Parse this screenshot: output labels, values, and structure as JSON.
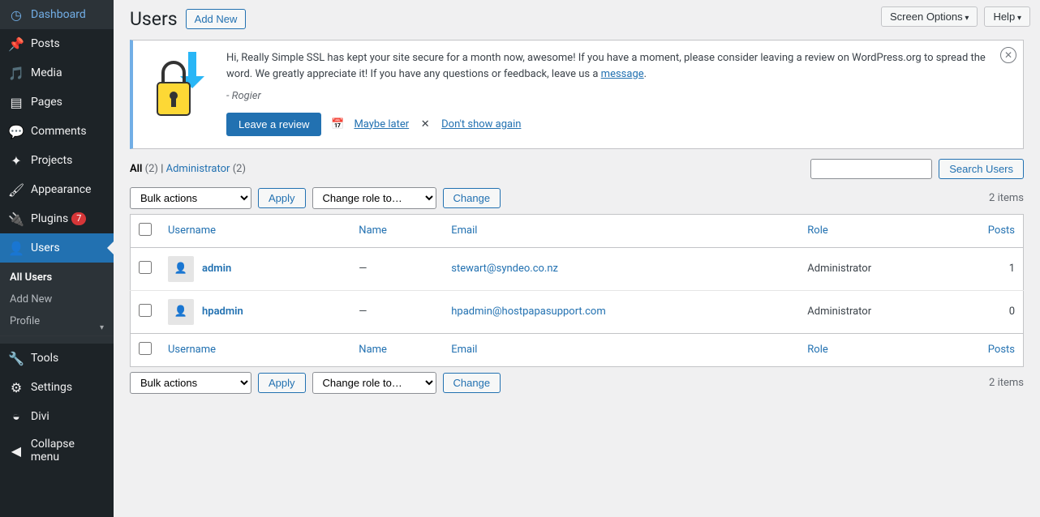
{
  "top": {
    "screen_options": "Screen Options",
    "help": "Help"
  },
  "sidebar": {
    "items": [
      {
        "label": "Dashboard"
      },
      {
        "label": "Posts"
      },
      {
        "label": "Media"
      },
      {
        "label": "Pages"
      },
      {
        "label": "Comments"
      },
      {
        "label": "Projects"
      },
      {
        "label": "Appearance"
      },
      {
        "label": "Plugins",
        "badge": "7"
      },
      {
        "label": "Users"
      },
      {
        "label": "Tools"
      },
      {
        "label": "Settings"
      },
      {
        "label": "Divi"
      },
      {
        "label": "Collapse menu"
      }
    ],
    "sub": [
      {
        "label": "All Users"
      },
      {
        "label": "Add New"
      },
      {
        "label": "Profile"
      }
    ]
  },
  "page": {
    "title": "Users",
    "add_new": "Add New"
  },
  "notice": {
    "text": "Hi, Really Simple SSL has kept your site secure for a month now, awesome! If you have a moment, please consider leaving a review on WordPress.org to spread the word. We greatly appreciate it! If you have any questions or feedback, leave us a ",
    "message_link": "message",
    "author": "- Rogier",
    "review_btn": "Leave a review",
    "later": "Maybe later",
    "dont_show": "Don't show again"
  },
  "filters": {
    "all": "All",
    "all_count": "(2)",
    "sep": " | ",
    "admin": "Administrator",
    "admin_count": "(2)"
  },
  "search": {
    "placeholder": "",
    "button": "Search Users"
  },
  "tablenav": {
    "bulk": "Bulk actions",
    "apply": "Apply",
    "change_role": "Change role to…",
    "change": "Change",
    "items": "2 items"
  },
  "columns": {
    "username": "Username",
    "name": "Name",
    "email": "Email",
    "role": "Role",
    "posts": "Posts"
  },
  "users": [
    {
      "username": "admin",
      "name": "—",
      "email": "stewart@syndeo.co.nz",
      "role": "Administrator",
      "posts": "1"
    },
    {
      "username": "hpadmin",
      "name": "—",
      "email": "hpadmin@hostpapasupport.com",
      "role": "Administrator",
      "posts": "0"
    }
  ]
}
